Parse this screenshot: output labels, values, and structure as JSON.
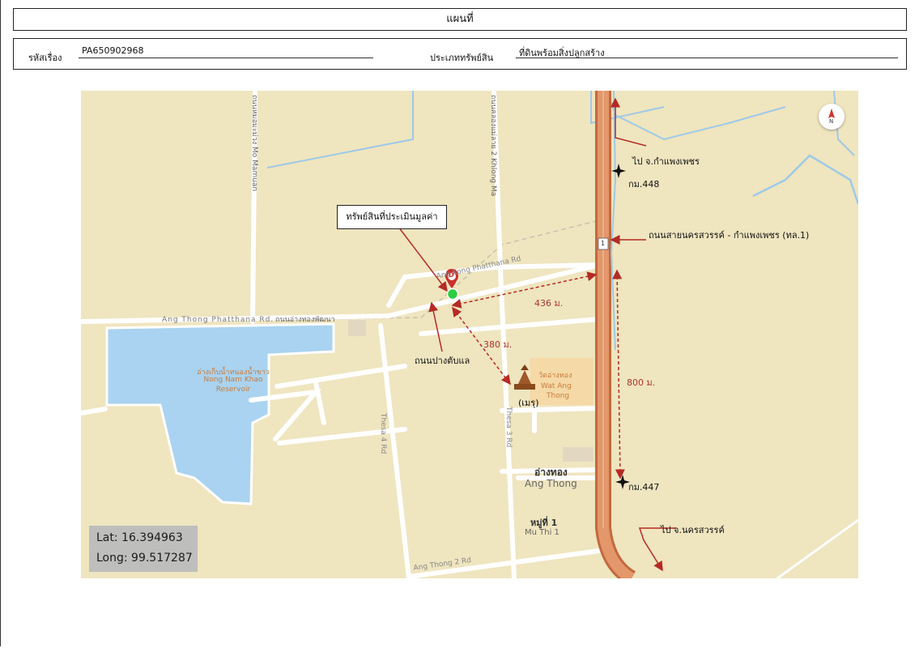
{
  "header": {
    "title": "แผนที่"
  },
  "info": {
    "case_label": "รหัสเรื่อง",
    "case_value": "PA650902968",
    "type_label": "ประเภททรัพย์สิน",
    "type_value": "ที่ดินพร้อมสิ่งปลูกสร้าง"
  },
  "map": {
    "coordinates": {
      "lat": "Lat: 16.394963",
      "long": "Long: 99.517287"
    },
    "compass_letter": "N",
    "property_callout": "ทรัพย์สินที่ประเมินมูลค่า",
    "marker_letter": "D",
    "highway_shield": "1",
    "annotations": {
      "to_kamphaeng_phet": "ไป จ.กำแพงเพชร",
      "km448": "กม.448",
      "highway_road": "ถนนสายนครสวรรค์ - กำแพงเพชร (ทล.1)",
      "km447": "กม.447",
      "to_nakhon_sawan": "ไป จ.นครสวรรค์",
      "road_pangtaplae": "ถนนปางตับแล",
      "landmark": "(เมรุ)"
    },
    "distances": {
      "d436": "436 ม.",
      "d380": "380 ม.",
      "d800": "800 ม."
    },
    "labels": {
      "ang_thong_rd": "Ang Thong Phatthana Rd.",
      "ang_thong_rd_th": "ถนนอ่างทองพัฒนา",
      "ang_kong_rd": "Ang Kong Phatthana Rd",
      "reservoir_th": "อ่างเก็บน้ำหนองน้ำขาว",
      "reservoir_en1": "Nong Nam Khao",
      "reservoir_en2": "Reservoir",
      "temple_th": "วัดอ่างทอง",
      "temple_en1": "Wat Ang",
      "temple_en2": "Thong",
      "town_th": "อ่างทอง",
      "town_en": "Ang Thong",
      "moo1_th": "หมู่ที่ 1",
      "moo1_en": "Mu Thi 1",
      "thesa4": "Thesa 4 Rd",
      "thesa3": "Thesa 3 Rd",
      "ang_thong2": "Ang Thong 2 Rd",
      "klong_mai": "ถนนคลองแม่ลาย 2 Khlong Ma",
      "mo_mamuan": "ถนนหมอมะม่วง Mo Mamuan"
    }
  },
  "colors": {
    "land": "#efe5bf",
    "water": "#a9d3f0",
    "road": "#ffffff",
    "highway": "#d98a5b",
    "arrow": "#b52a24",
    "property": "#2ecc40"
  }
}
